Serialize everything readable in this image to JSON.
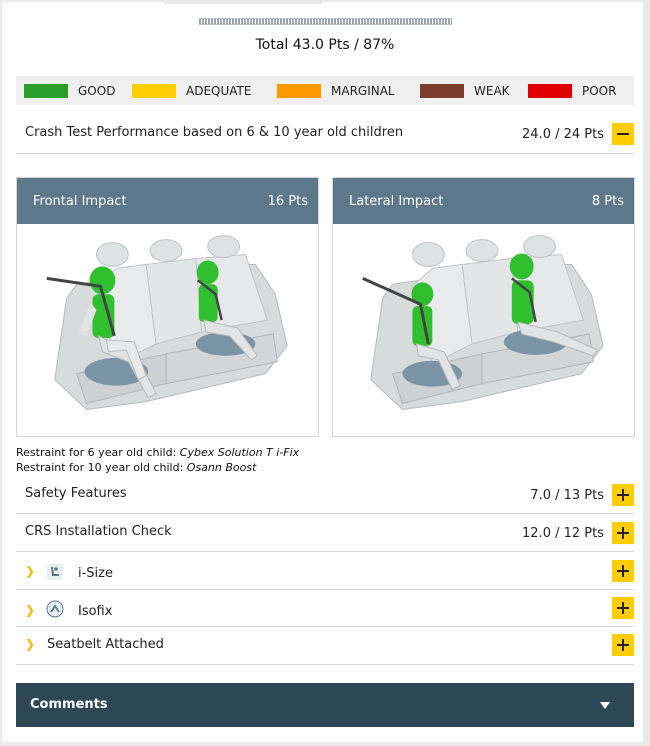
{
  "total": "Total 43.0 Pts / 87%",
  "legend": [
    {
      "label": "GOOD",
      "color": "#2a9d2a"
    },
    {
      "label": "ADEQUATE",
      "color": "#ffcd00"
    },
    {
      "label": "MARGINAL",
      "color": "#ff9900"
    },
    {
      "label": "WEAK",
      "color": "#7a3e2a"
    },
    {
      "label": "POOR",
      "color": "#e00000"
    }
  ],
  "crash": {
    "title": "Crash Test Performance based on 6 & 10 year old children",
    "pts": "24.0 / 24 Pts"
  },
  "frontal": {
    "title": "Frontal Impact",
    "pts": "16 Pts"
  },
  "lateral": {
    "title": "Lateral Impact",
    "pts": "8 Pts"
  },
  "restraint": {
    "six_label": "Restraint for 6 year old child: ",
    "six_value": "Cybex Solution T i-Fix",
    "ten_label": "Restraint for 10 year old child: ",
    "ten_value": "Osann Boost"
  },
  "safety": {
    "title": "Safety Features",
    "pts": "7.0 / 13 Pts"
  },
  "crs": {
    "title": "CRS Installation Check",
    "pts": "12.0 / 12 Pts"
  },
  "isize": {
    "title": "i-Size",
    "icon": "child-seat-icon"
  },
  "isofix": {
    "title": "Isofix",
    "icon": "isofix-icon"
  },
  "seatbelt": {
    "title": "Seatbelt Attached"
  },
  "comments": {
    "title": "Comments"
  }
}
